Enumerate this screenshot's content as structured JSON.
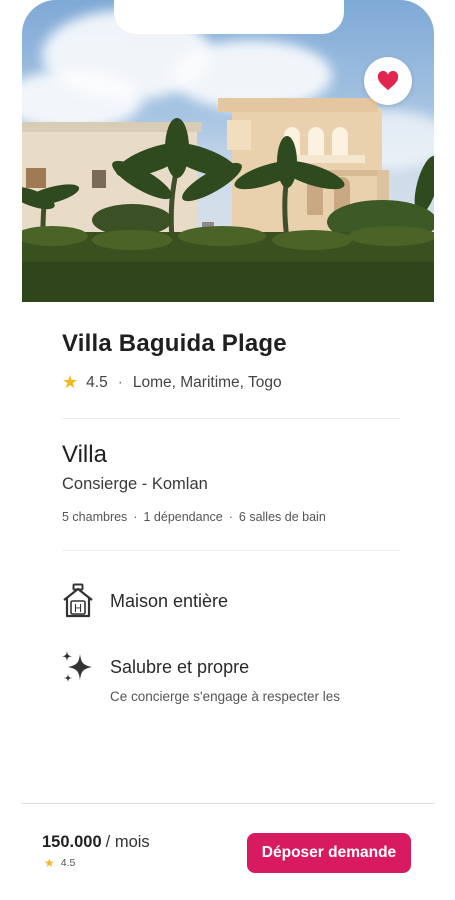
{
  "listing": {
    "title": "Villa Baguida Plage",
    "rating": "4.5",
    "location": "Lome, Maritime, Togo",
    "type": "Villa",
    "host": "Consierge - Komlan",
    "specs": [
      "5 chambres",
      "1 dépendance",
      "6 salles de bain"
    ]
  },
  "features": [
    {
      "icon": "house-icon",
      "title": "Maison entière",
      "subtitle": ""
    },
    {
      "icon": "sparkles-icon",
      "title": "Salubre et propre",
      "subtitle": "Ce concierge s'engage à respecter les"
    }
  ],
  "footer": {
    "price": "150.000",
    "per": "/ mois",
    "rating": "4.5",
    "cta_label": "Déposer demande"
  },
  "colors": {
    "accent": "#d81b60",
    "star": "#f5b71c",
    "favorite": "#e0264f"
  }
}
